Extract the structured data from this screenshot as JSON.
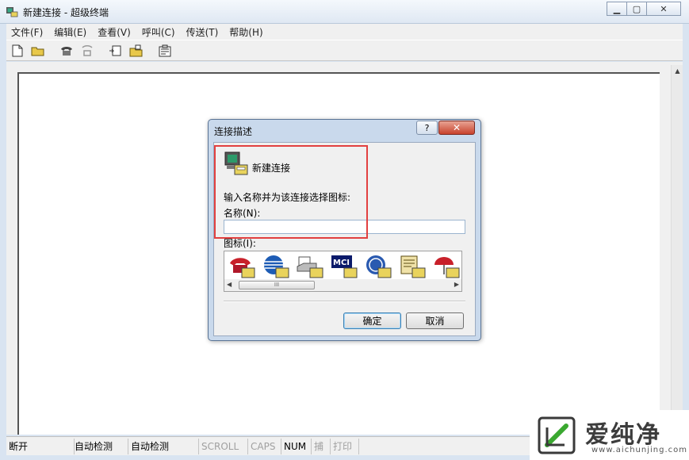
{
  "window": {
    "title": "新建连接 - 超级终端"
  },
  "menu": [
    "文件(F)",
    "编辑(E)",
    "查看(V)",
    "呼叫(C)",
    "传送(T)",
    "帮助(H)"
  ],
  "toolbar": [
    "new-file-icon",
    "open-folder-icon",
    "phone-icon",
    "disconnect-icon",
    "send-icon",
    "receive-icon",
    "properties-icon"
  ],
  "dialog": {
    "title": "连接描述",
    "help_label": "?",
    "close_label": "✕",
    "connection_name": "新建连接",
    "prompt": "输入名称并为该连接选择图标:",
    "name_label": "名称(N):",
    "name_value": "",
    "icon_label": "图标(I):",
    "icons": [
      "phone-red-icon",
      "att-globe-icon",
      "fax-machine-icon",
      "mci-icon",
      "ge-icon",
      "document-icon",
      "umbrella-icon"
    ],
    "scroll_thumb": "III",
    "ok_label": "确定",
    "cancel_label": "取消"
  },
  "status": [
    {
      "text": "断开",
      "active": true
    },
    {
      "text": "自动检测",
      "active": true
    },
    {
      "text": "自动检测",
      "active": true
    },
    {
      "text": "SCROLL",
      "active": false
    },
    {
      "text": "CAPS",
      "active": false
    },
    {
      "text": "NUM",
      "active": true
    },
    {
      "text": "捕",
      "active": false
    },
    {
      "text": "打印",
      "active": false
    }
  ],
  "watermark": {
    "text": "爱纯净",
    "url": "www.aichunjing.com"
  },
  "colors": {
    "highlight": "#e24040",
    "dialog_frame": "#c9d9ec",
    "close_red": "#c8422d"
  }
}
